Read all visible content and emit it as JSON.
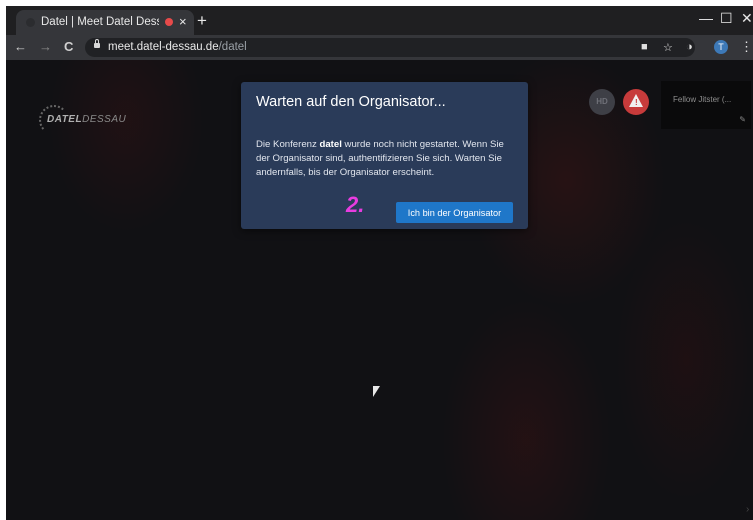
{
  "browser": {
    "tab": {
      "title": "Datel | Meet Datel Dess",
      "close": "×"
    },
    "new_tab": "+",
    "window": {
      "minimize": "—",
      "maximize": "☐",
      "close": "✕"
    },
    "nav": {
      "back": "←",
      "forward": "→",
      "reload": "C"
    },
    "url_host": "meet.datel-dessau.de",
    "url_path": "/datel",
    "account_initial": "T",
    "menu": "⋮"
  },
  "logo": {
    "part1": "DATEL",
    "part2": "DESSAU"
  },
  "toolbar": {
    "hd_label": "HD"
  },
  "thumbnail": {
    "name": "Fellow Jitster (..."
  },
  "dialog": {
    "title": "Warten auf den Organisator...",
    "body_prefix": "Die Konferenz ",
    "room": "datel",
    "body_suffix": " wurde noch nicht gestartet. Wenn Sie der Organisator sind, authentifizieren Sie sich. Warten Sie andernfalls, bis der Organisator erscheint.",
    "annotation": "2.",
    "button_label": "Ich bin der Organisator"
  },
  "colors": {
    "dialog_bg": "#2a3b59",
    "button_bg": "#1f77c9",
    "annotation": "#e83ce0",
    "warning": "#c73b3b"
  }
}
